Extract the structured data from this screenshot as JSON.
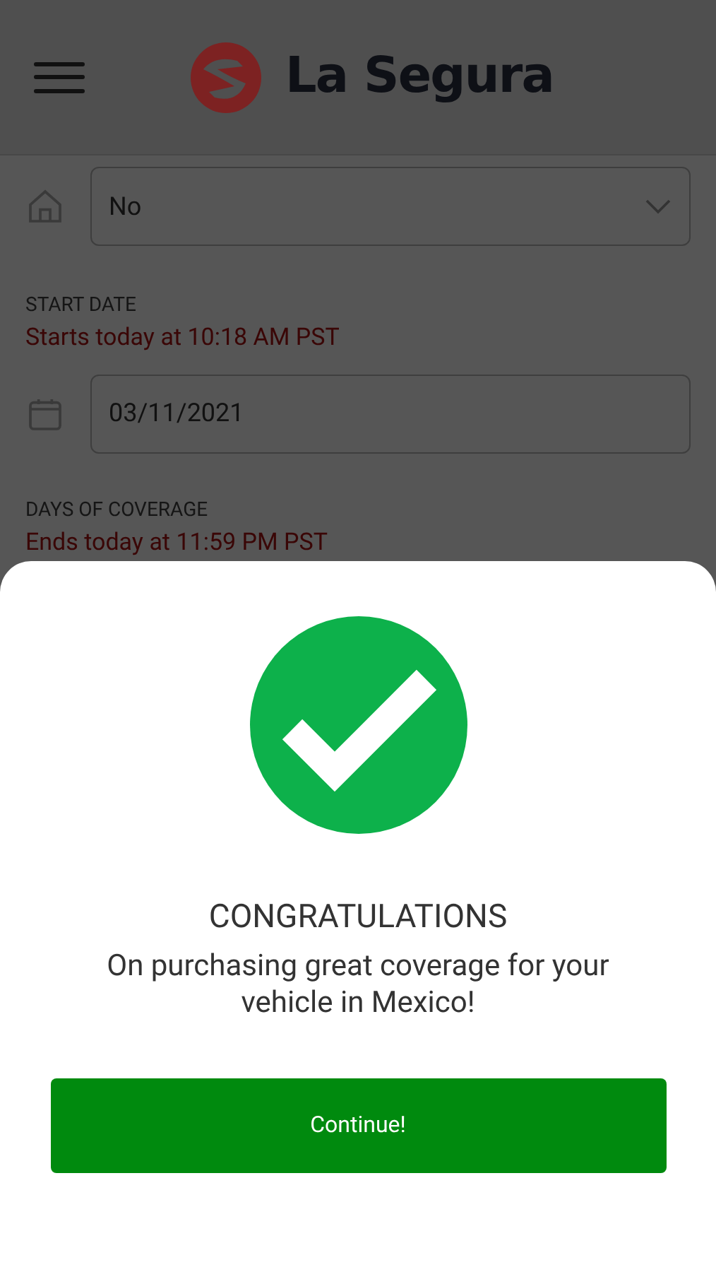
{
  "header": {
    "brand": "La Segura"
  },
  "form": {
    "select_value": "No",
    "start_date_label": "START DATE",
    "start_date_note": "Starts today at 10:18 AM PST",
    "date_value": "03/11/2021",
    "coverage_label": "DAYS OF COVERAGE",
    "coverage_note": "Ends today at 11:59 PM PST"
  },
  "dialog": {
    "title": "CONGRATULATIONS",
    "message": "On purchasing great coverage for your vehicle in Mexico!",
    "button": "Continue!"
  }
}
